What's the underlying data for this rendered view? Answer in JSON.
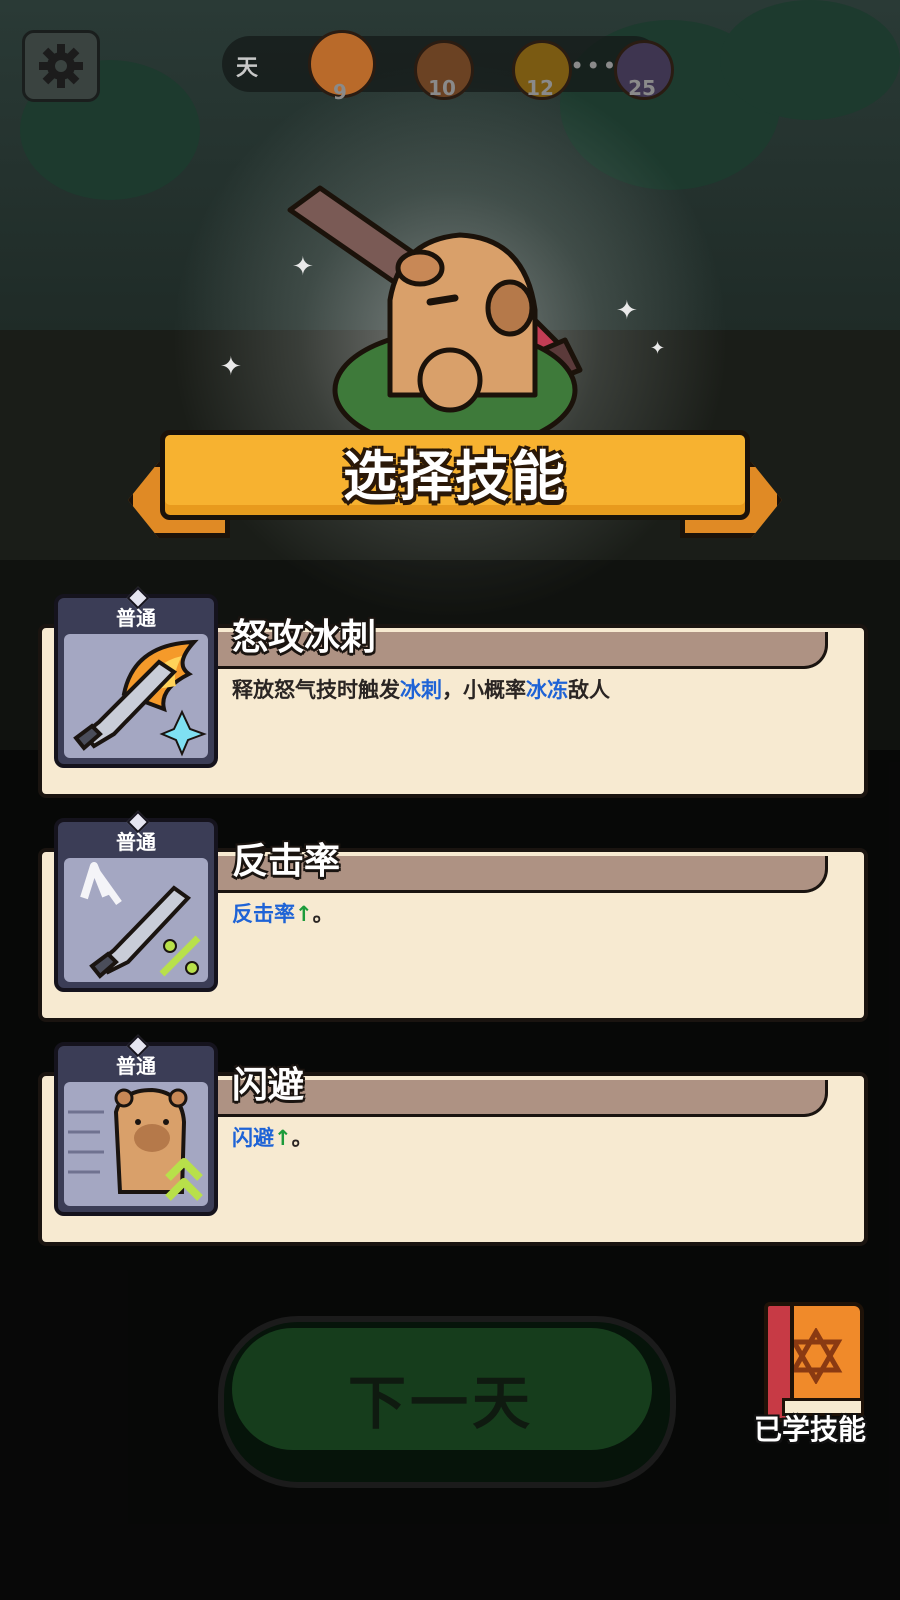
{
  "top_bar": {
    "day_label": "天",
    "stages": [
      {
        "number": "9",
        "icon": "crossed-swords-icon",
        "current": true
      },
      {
        "number": "10",
        "icon": "crossed-swords-icon",
        "current": false
      },
      {
        "number": "12",
        "icon": "question-mark-icon",
        "current": false
      },
      {
        "number": "25",
        "icon": "skull-boss-icon",
        "current": false
      }
    ],
    "ellipsis": "•••"
  },
  "title": "选择技能",
  "skills": [
    {
      "tier": "普通",
      "name": "怒攻冰刺",
      "icon": "flaming-sword-ice-icon",
      "desc_parts": [
        {
          "text": "释放怒气技时触发",
          "style": "normal"
        },
        {
          "text": "冰刺",
          "style": "keyword"
        },
        {
          "text": "，小概率",
          "style": "normal"
        },
        {
          "text": "冰冻",
          "style": "keyword"
        },
        {
          "text": "敌人",
          "style": "normal"
        }
      ]
    },
    {
      "tier": "普通",
      "name": "反击率",
      "icon": "counter-sword-percent-icon",
      "desc_parts": [
        {
          "text": "反击率",
          "style": "keyword"
        },
        {
          "text": "↑",
          "style": "up"
        },
        {
          "text": "。",
          "style": "normal"
        }
      ]
    },
    {
      "tier": "普通",
      "name": "闪避",
      "icon": "dodging-capybara-icon",
      "desc_parts": [
        {
          "text": "闪避",
          "style": "keyword"
        },
        {
          "text": "↑",
          "style": "up"
        },
        {
          "text": "。",
          "style": "normal"
        }
      ]
    }
  ],
  "next_day_button": "下一天",
  "learned_skills_label": "已学技能",
  "colors": {
    "keyword": "#1e63d6",
    "up_arrow": "#1c9b3a",
    "banner": "#f7b230",
    "card_bg": "#f7ead1",
    "icon_frame": "#3b3d56"
  }
}
